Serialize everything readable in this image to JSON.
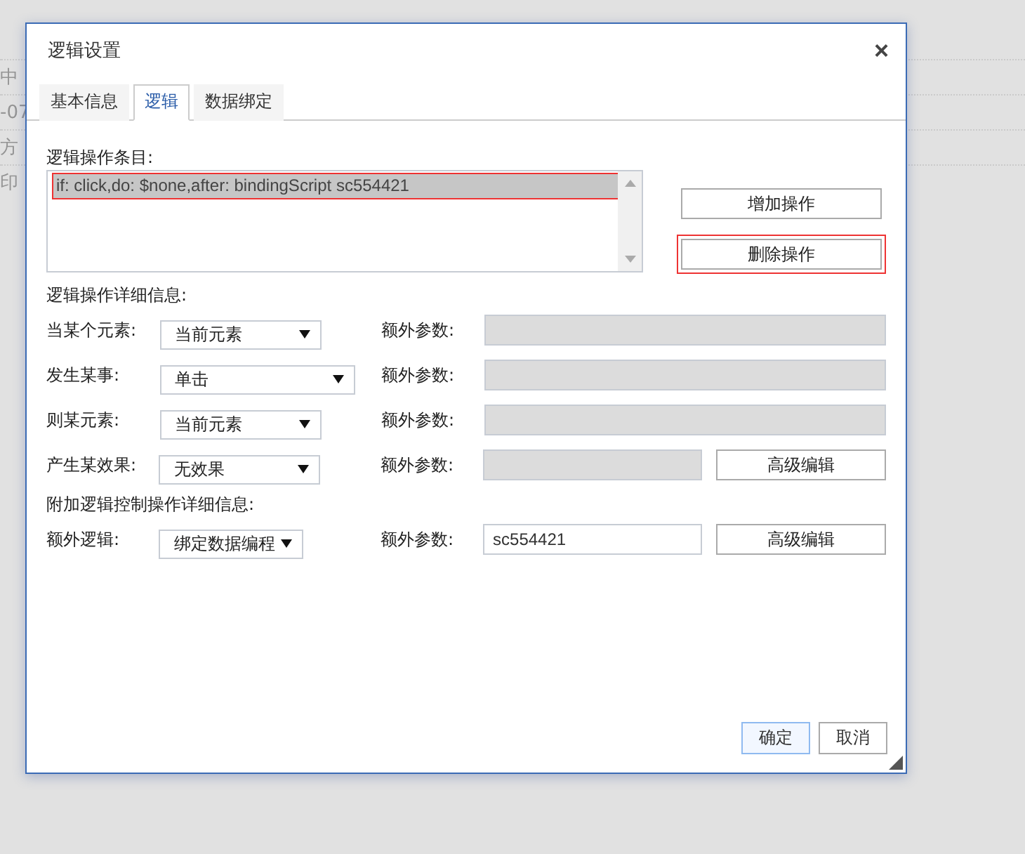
{
  "background": {
    "rows": [
      {
        "text": "中"
      },
      {
        "text": "-07"
      },
      {
        "text": "方"
      },
      {
        "text": "印"
      }
    ]
  },
  "dialog": {
    "title": "逻辑设置",
    "close": "×",
    "tabs": [
      {
        "label": "基本信息",
        "selected": false
      },
      {
        "label": "逻辑",
        "selected": true
      },
      {
        "label": "数据绑定",
        "selected": false
      }
    ],
    "list_label": "逻辑操作条目:",
    "items": [
      {
        "text": "if: click,do: $none,after: bindingScript sc554421",
        "selected": true
      }
    ],
    "list_buttons": [
      {
        "label": "增加操作",
        "highlighted": false
      },
      {
        "label": "删除操作",
        "highlighted": true
      }
    ],
    "details_label": "逻辑操作详细信息:",
    "rows": [
      {
        "label": "当某个元素:",
        "select": "当前元素",
        "param_label": "额外参数:",
        "param": {
          "disabled": true
        }
      },
      {
        "label": "发生某事:",
        "select": "单击",
        "param_label": "额外参数:",
        "param": {
          "disabled": true
        }
      },
      {
        "label": "则某元素:",
        "select": "当前元素",
        "param_label": "额外参数:",
        "param": {
          "disabled": true
        }
      },
      {
        "label": "产生某效果:",
        "select": "无效果",
        "param_label": "额外参数:",
        "param": {
          "disabled": true
        },
        "button": "高级编辑"
      }
    ],
    "extra_label": "附加逻辑控制操作详细信息:",
    "extra_rows": [
      {
        "label": "额外逻辑:",
        "select": "绑定数据编程",
        "param_label": "额外参数:",
        "param": {
          "disabled": false,
          "value": "sc554421"
        },
        "button": "高级编辑"
      }
    ],
    "footer": [
      {
        "label": "确定",
        "primary": true
      },
      {
        "label": "取消",
        "primary": false
      }
    ]
  }
}
